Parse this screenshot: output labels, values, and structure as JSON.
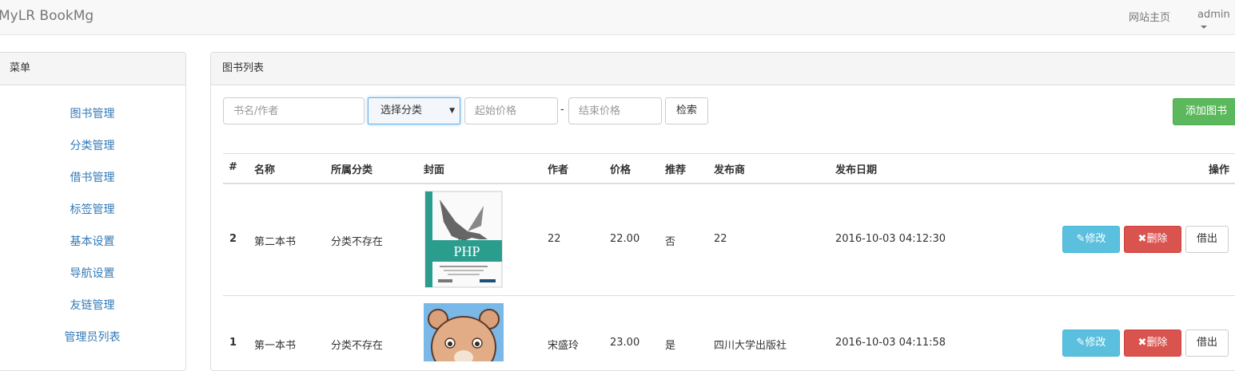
{
  "navbar": {
    "brand": "MyLR BookMg",
    "home_link": "网站主页",
    "user": "admin"
  },
  "sidebar": {
    "title": "菜单",
    "items": [
      {
        "label": "图书管理"
      },
      {
        "label": "分类管理"
      },
      {
        "label": "借书管理"
      },
      {
        "label": "标签管理"
      },
      {
        "label": "基本设置"
      },
      {
        "label": "导航设置"
      },
      {
        "label": "友链管理"
      },
      {
        "label": "管理员列表"
      }
    ]
  },
  "main": {
    "title": "图书列表",
    "search": {
      "keyword_placeholder": "书名/作者",
      "category_selected": "选择分类",
      "price_from_placeholder": "起始价格",
      "price_separator": "-",
      "price_to_placeholder": "结束价格",
      "search_button": "检索"
    },
    "add_button": "添加图书",
    "table": {
      "headers": [
        "#",
        "名称",
        "所属分类",
        "封面",
        "作者",
        "价格",
        "推荐",
        "发布商",
        "发布日期",
        "操作"
      ],
      "rows": [
        {
          "id": "2",
          "name": "第二本书",
          "category": "分类不存在",
          "cover": "php-book-cover",
          "author": "22",
          "price": "22.00",
          "recommend": "否",
          "publisher": "22",
          "date": "2016-10-03 04:12:30",
          "cover_text": "PHP"
        },
        {
          "id": "1",
          "name": "第一本书",
          "category": "分类不存在",
          "cover": "bear-cover",
          "author": "宋盛玲",
          "price": "23.00",
          "recommend": "是",
          "publisher": "四川大学出版社",
          "date": "2016-10-03 04:11:58"
        }
      ],
      "actions": {
        "edit": "修改",
        "delete": "删除",
        "borrow": "借出"
      }
    }
  },
  "colors": {
    "link": "#337ab7",
    "success": "#5cb85c",
    "info": "#5bc0de",
    "danger": "#d9534f"
  }
}
